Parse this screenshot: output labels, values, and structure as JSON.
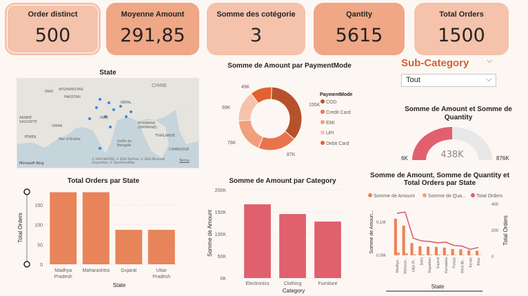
{
  "kpis": [
    {
      "label": "Order distinct",
      "value": "500"
    },
    {
      "label": "Moyenne Amount",
      "value": "291,85"
    },
    {
      "label": "Somme des cotégorie",
      "value": "3"
    },
    {
      "label": "Qantity",
      "value": "5615"
    },
    {
      "label": "Total Orders",
      "value": "1500"
    }
  ],
  "map": {
    "title": "State",
    "labels": [
      "CHINE",
      "IRAN",
      "AFGHANISTAN",
      "PAKISTAN",
      "INDE",
      "ARABIE SAOUDITE",
      "YÉMEN",
      "NÉPAL",
      "MYANMAR (BIRMANIE)",
      "THAÏLANDE",
      "Mer d'Arabie",
      "Golfe du Bengale",
      "OMAN",
      "CAMBODGE"
    ],
    "brand": "Microsoft Bing",
    "credit": "© 2024 NAVTEQ, © 2024 TomTom, © 2024 Microsoft Corporation, © OpenStreetMap",
    "terms": "Terms"
  },
  "donut": {
    "title": "Somme de Amount par PaymentMode",
    "legend_title": "PaymentMode",
    "labels": [
      "49K",
      "69K",
      "78K",
      "87K",
      "155K"
    ]
  },
  "slicer": {
    "title": "Sub-Category",
    "value": "Tout"
  },
  "gauge": {
    "title": "Somme de Amount et Somme de Quantity",
    "value": "438K",
    "min": "6K",
    "max": "876K"
  },
  "bar_state": {
    "title": "Total Orders par State",
    "ylabel": "Total Orders",
    "xlabel": "State"
  },
  "bar_category": {
    "title": "Somme de Amount par Category",
    "ylabel": "Somme de Amount",
    "xlabel": "Category"
  },
  "combo": {
    "title": "Somme de Amount, Somme de Quantity et Total Orders par State",
    "legend": [
      "Somme de Amount",
      "Somme de Qua...",
      "Total Orders"
    ],
    "ylabel_left": "Somme de Amoun...",
    "ylabel_right": "Total Orders",
    "xlabel": "State",
    "left_ticks": [
      "0,1M",
      "0,0M"
    ],
    "right_ticks": [
      "400",
      "200",
      "0"
    ]
  },
  "chart_data": [
    {
      "type": "pie",
      "title": "Somme de Amount par PaymentMode",
      "categories": [
        "COD",
        "Credit Card",
        "EMI",
        "UPI",
        "Debit Card"
      ],
      "values": [
        155,
        87,
        78,
        69,
        49
      ],
      "unit": "K",
      "colors": [
        "#b5522b",
        "#e8744d",
        "#f0a07c",
        "#f6c2ab",
        "#e2622f"
      ]
    },
    {
      "type": "bar",
      "title": "Total Orders par State",
      "categories": [
        "Madhya Pradesh",
        "Maharashtra",
        "Gujarat",
        "Uttar Pradesh"
      ],
      "values": [
        182,
        182,
        87,
        87
      ],
      "ylim": [
        0,
        190
      ],
      "ticks": [
        0,
        50,
        100,
        150
      ],
      "xlabel": "State",
      "ylabel": "Total Orders"
    },
    {
      "type": "bar",
      "title": "Somme de Amount par Category",
      "categories": [
        "Electronics",
        "Clothing",
        "Furniture"
      ],
      "values": [
        167,
        145,
        128
      ],
      "unit": "K",
      "ylim": [
        0,
        200
      ],
      "ticks": [
        0,
        50,
        100,
        150,
        200
      ],
      "tick_labels": [
        "0K",
        "50K",
        "100K",
        "150K",
        "200K"
      ],
      "xlabel": "Category",
      "ylabel": "Somme de Amount"
    },
    {
      "type": "bar",
      "title": "Somme de Amount, Somme de Quantity et Total Orders par State",
      "categories": [
        "Madhya...",
        "Maharas...",
        "Uttar Pr...",
        "Delhi",
        "Rajasthan",
        "Gujarat",
        "Karnataka",
        "Punjab",
        "West Be...",
        "Kerala",
        "Bihar"
      ],
      "series": [
        {
          "name": "Somme de Amount",
          "values": [
            0.105,
            0.085,
            0.035,
            0.026,
            0.025,
            0.024,
            0.022,
            0.018,
            0.017,
            0.014,
            0.013
          ]
        },
        {
          "name": "Somme de Qua...",
          "values": [
            0.008,
            0.006,
            0.003,
            0.002,
            0.002,
            0.002,
            0.002,
            0.001,
            0.001,
            0.001,
            0.001
          ]
        },
        {
          "name": "Total Orders",
          "values": [
            320,
            330,
            130,
            110,
            105,
            95,
            100,
            75,
            70,
            45,
            60
          ]
        }
      ],
      "ylim_left": [
        0,
        0.15
      ],
      "ylim_right": [
        0,
        400
      ],
      "xlabel": "State"
    }
  ]
}
